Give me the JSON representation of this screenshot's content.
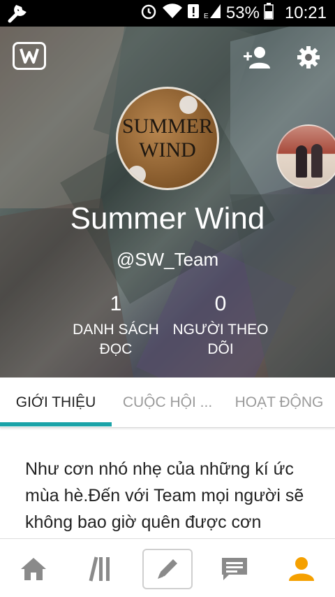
{
  "status_bar": {
    "battery": "53%",
    "time": "10:21",
    "icons": [
      "wrench-icon",
      "alarm-icon",
      "wifi-icon",
      "alert-icon",
      "signal-icon",
      "battery-icon"
    ]
  },
  "profile": {
    "avatar_text_line1": "SUMMER",
    "avatar_text_line2": "WIND",
    "name": "Summer Wind",
    "handle": "@SW_Team",
    "stats": {
      "reading_lists_count": "1",
      "reading_lists_label": "DANH SÁCH ĐỌC",
      "followers_count": "0",
      "followers_label": "NGƯỜI THEO DÕI"
    }
  },
  "tabs": [
    {
      "label": "GIỚI THIỆU",
      "active": true
    },
    {
      "label": "CUỘC HỘI ...",
      "active": false
    },
    {
      "label": "HOẠT ĐỘNG",
      "active": false
    }
  ],
  "about": {
    "text": "Như cơn nhó nhẹ của những kí ức mùa hè.Đến với Team mọi người sẽ không bao giờ quên được cơn"
  },
  "bottom_nav": {
    "items": [
      "home-icon",
      "library-icon",
      "write-icon",
      "messages-icon",
      "profile-icon"
    ]
  },
  "colors": {
    "accent": "#1aa3a8",
    "profile_active": "#f5a000",
    "nav_icon": "#8a8a8a"
  }
}
